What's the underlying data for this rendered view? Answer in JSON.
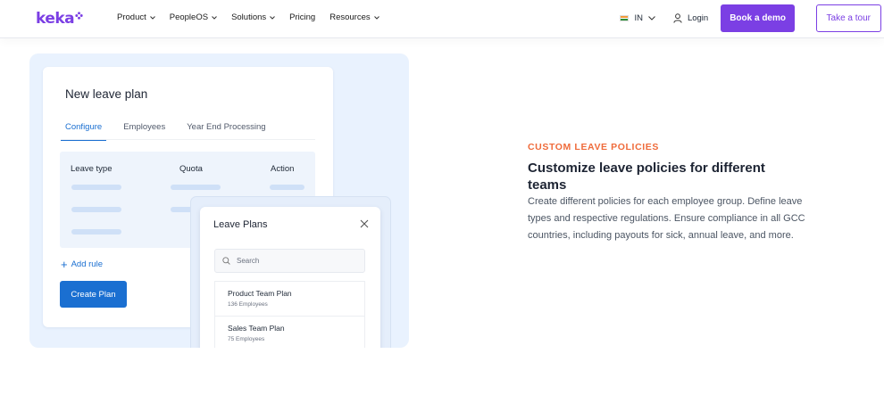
{
  "nav": {
    "logo": "keka",
    "menu": [
      {
        "label": "Product",
        "dropdown": true
      },
      {
        "label": "PeopleOS",
        "dropdown": true
      },
      {
        "label": "Solutions",
        "dropdown": true
      },
      {
        "label": "Pricing",
        "dropdown": false
      },
      {
        "label": "Resources",
        "dropdown": true
      }
    ],
    "locale": "IN",
    "login": "Login",
    "demo_button": "Book a demo",
    "tour_button": "Take a tour"
  },
  "illustration": {
    "card_title": "New leave plan",
    "tabs": [
      "Configure",
      "Employees",
      "Year End Processing"
    ],
    "table_headers": [
      "Leave type",
      "Quota",
      "Action"
    ],
    "add_rule": "Add rule",
    "create_button": "Create Plan",
    "modal": {
      "title": "Leave Plans",
      "search_placeholder": "Search",
      "plans": [
        {
          "name": "Product Team Plan",
          "count": "136 Employees"
        },
        {
          "name": "Sales Team Plan",
          "count": "75 Employees"
        }
      ]
    }
  },
  "feature": {
    "eyebrow": "CUSTOM LEAVE POLICIES",
    "heading": "Customize leave policies for different teams",
    "description": "Create different policies for each employee group. Define leave types and respective regulations. Ensure compliance in all GCC countries, including payouts for sick, annual leave, and more."
  },
  "colors": {
    "brand": "#7b3fe4",
    "accent": "#1a6fd1",
    "eyebrow": "#ef6b3b"
  }
}
